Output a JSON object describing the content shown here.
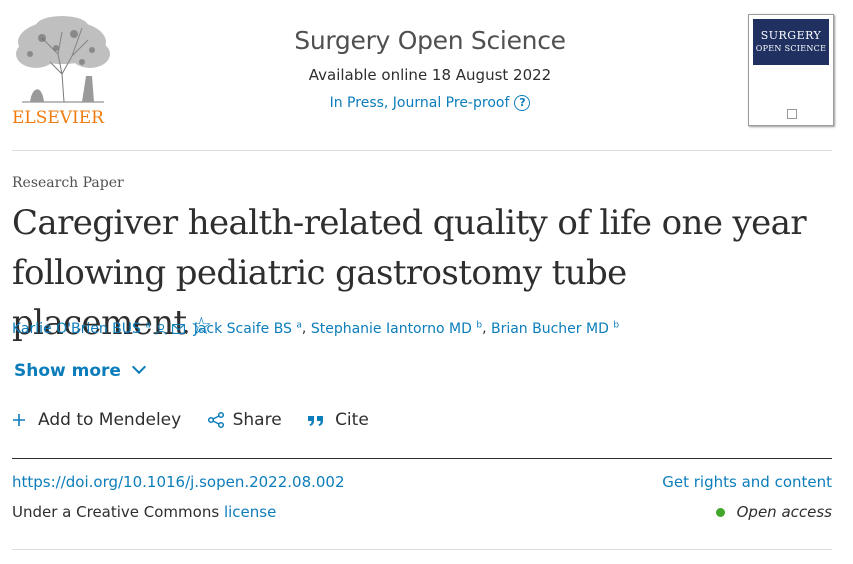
{
  "publisher": {
    "name": "ELSEVIER",
    "brand_color": "#f07b0f"
  },
  "journal": {
    "title": "Surgery Open Science",
    "available": "Available online 18 August 2022",
    "status": "In Press, Journal Pre-proof",
    "help_icon": "question-circle-icon",
    "cover_line1": "SURGERY",
    "cover_line2": "OPEN SCIENCE"
  },
  "article": {
    "type": "Research Paper",
    "title": "Caregiver health-related quality of life one year following pediatric gastrostomy tube placement",
    "star_glyph": "☆",
    "authors": [
      {
        "name": "Karlie O'Brien BUS",
        "affil": "a"
      },
      {
        "name": "Jack Scaife BS",
        "affil": "a"
      },
      {
        "name": "Stephanie Iantorno MD",
        "affil": "b"
      },
      {
        "name": "Brian Bucher MD",
        "affil": "b"
      }
    ],
    "show_more": "Show more"
  },
  "actions": {
    "mendeley": "Add to Mendeley",
    "share": "Share",
    "cite": "Cite"
  },
  "links": {
    "doi": "https://doi.org/10.1016/j.sopen.2022.08.002",
    "rights": "Get rights and content",
    "license_prefix": "Under a Creative Commons",
    "license_link": "license",
    "open_access": "Open access"
  },
  "colors": {
    "link": "#0c7dbb",
    "cover": "#1f3061",
    "open_access_dot": "#41a62a"
  }
}
